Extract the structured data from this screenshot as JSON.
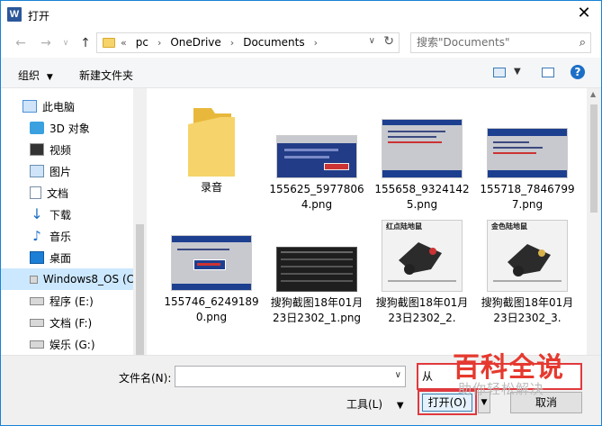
{
  "window": {
    "title": "打开",
    "app_icon_letter": "W"
  },
  "address": {
    "crumbs": [
      "pc",
      "OneDrive",
      "Documents"
    ],
    "search_placeholder": "搜索\"Documents\""
  },
  "toolbar": {
    "organize": "组织",
    "new_folder": "新建文件夹"
  },
  "nav_items": [
    {
      "label": "此电脑",
      "icon": "computer-icon"
    },
    {
      "label": "3D 对象",
      "icon": "3d-objects-icon"
    },
    {
      "label": "视频",
      "icon": "video-icon"
    },
    {
      "label": "图片",
      "icon": "picture-icon"
    },
    {
      "label": "文档",
      "icon": "document-icon"
    },
    {
      "label": "下载",
      "icon": "download-icon"
    },
    {
      "label": "音乐",
      "icon": "music-icon"
    },
    {
      "label": "桌面",
      "icon": "desktop-icon"
    },
    {
      "label": "Windows8_OS (C",
      "icon": "drive-icon"
    },
    {
      "label": "程序 (E:)",
      "icon": "drive-icon"
    },
    {
      "label": "文档 (F:)",
      "icon": "drive-icon"
    },
    {
      "label": "娱乐 (G:)",
      "icon": "drive-icon"
    }
  ],
  "files": [
    {
      "label": "录音",
      "type": "folder"
    },
    {
      "label": "155625_59778064.png",
      "type": "bios"
    },
    {
      "label": "155658_93241425.png",
      "type": "bios"
    },
    {
      "label": "155718_78467997.png",
      "type": "bios"
    },
    {
      "label": "155746_62491890.png",
      "type": "bios"
    },
    {
      "label": "搜狗截图18年01月23日2302_1.png",
      "type": "dark"
    },
    {
      "label": "搜狗截图18年01月23日2302_2.",
      "type": "light",
      "caption": "红点陆地鼠"
    },
    {
      "label": "搜狗截图18年01月23日2302_3.",
      "type": "light",
      "caption": "金色陆地鼠"
    }
  ],
  "bottom": {
    "filename_label": "文件名(N):",
    "filename_value": "",
    "filter_value": "从",
    "tools_label": "工具(L)",
    "open_label": "打开(O)",
    "cancel_label": "取消"
  },
  "watermark": {
    "title": "百科全说",
    "subtitle": "助你轻松解决"
  },
  "colors": {
    "accent": "#1883d7",
    "highlight": "#e0393e",
    "selected": "#cce8ff",
    "folder": "#f6d36b"
  }
}
